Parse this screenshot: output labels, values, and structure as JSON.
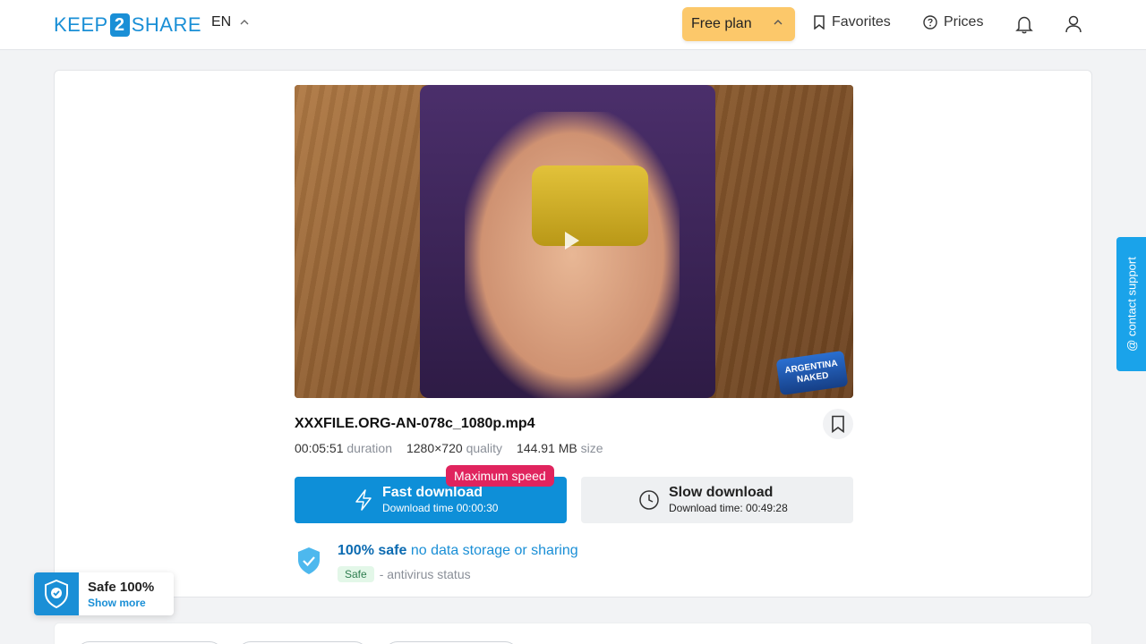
{
  "header": {
    "logo_left": "KEEP",
    "logo_mid": "2",
    "logo_right": "SHARE",
    "language": "EN",
    "free_plan_label": "Free plan",
    "favorites_label": "Favorites",
    "prices_label": "Prices"
  },
  "video": {
    "watermark": "ARGENTINA NAKED"
  },
  "file": {
    "name": "XXXFILE.ORG-AN-078c_1080p.mp4",
    "duration_value": "00:05:51",
    "duration_label": "duration",
    "quality_value": "1280×720",
    "quality_label": "quality",
    "size_value": "144.91 MB",
    "size_label": "size"
  },
  "download": {
    "badge": "Maximum speed",
    "fast_title": "Fast download",
    "fast_sub": "Download time 00:00:30",
    "slow_title": "Slow download",
    "slow_sub": "Download time: 00:49:28"
  },
  "safety": {
    "headline_bold": "100% safe",
    "headline_rest": "no data storage or sharing",
    "status_pill": "Safe",
    "status_text": "- antivirus status"
  },
  "safe_widget": {
    "title": "Safe 100%",
    "link": "Show more"
  },
  "support": {
    "label": "@ contact support"
  },
  "colors": {
    "brand_blue": "#1a8fd6",
    "free_plan_bg": "#fcc86a",
    "badge_red": "#e0245e"
  }
}
